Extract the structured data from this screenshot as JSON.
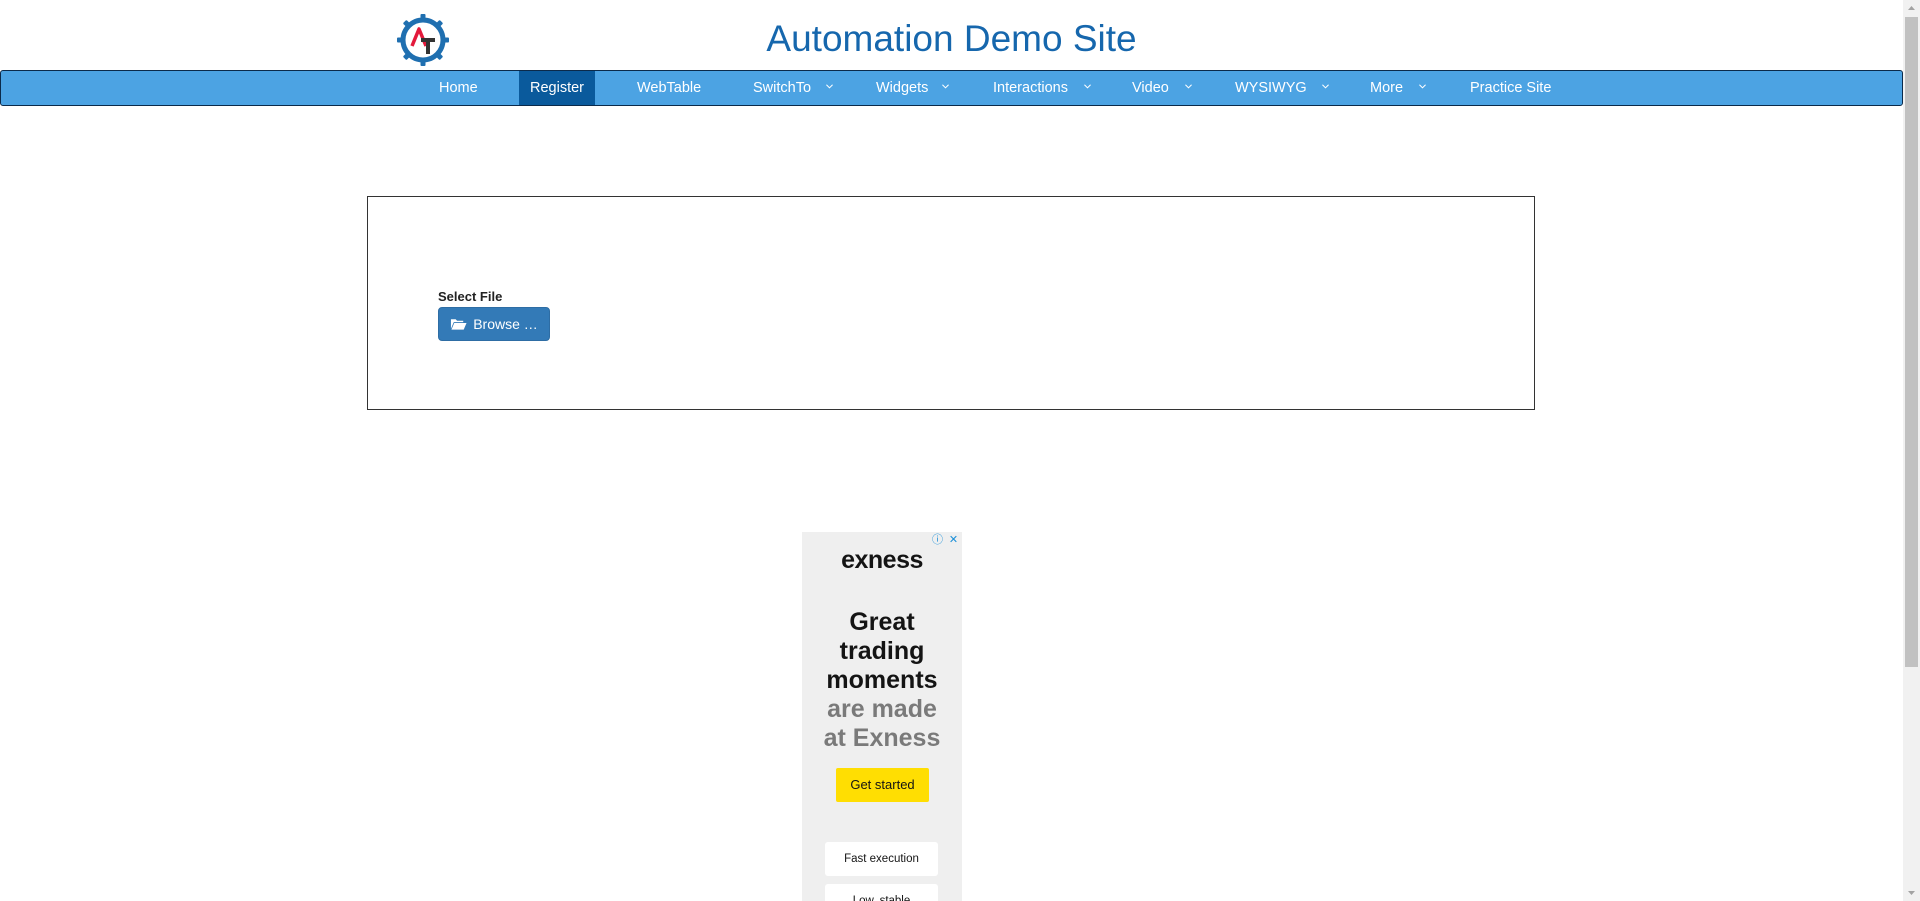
{
  "header": {
    "title": "Automation Demo Site",
    "logo_icon": "gear-logo-icon"
  },
  "nav": {
    "items": [
      {
        "label": "Home"
      },
      {
        "label": "Register",
        "active": true
      },
      {
        "label": "WebTable"
      },
      {
        "label": "SwitchTo",
        "dropdown": true
      },
      {
        "label": "Widgets",
        "dropdown": true
      },
      {
        "label": "Interactions",
        "dropdown": true
      },
      {
        "label": "Video",
        "dropdown": true
      },
      {
        "label": "WYSIWYG",
        "dropdown": true
      },
      {
        "label": "More",
        "dropdown": true
      },
      {
        "label": "Practice Site"
      }
    ]
  },
  "upload": {
    "label": "Select File",
    "button_label": "Browse …",
    "button_icon": "folder-open-icon"
  },
  "ad": {
    "brand": "exness",
    "headline_dark": "Great trading moments",
    "headline_muted": "are made at Exness",
    "cta": "Get started",
    "features": [
      "Fast execution",
      "Low, stable"
    ]
  },
  "colors": {
    "nav_bg": "#4ca3e3",
    "nav_active": "#0a5a9c",
    "title": "#1667ad",
    "button": "#337ab7",
    "ad_cta": "#ffde02"
  }
}
